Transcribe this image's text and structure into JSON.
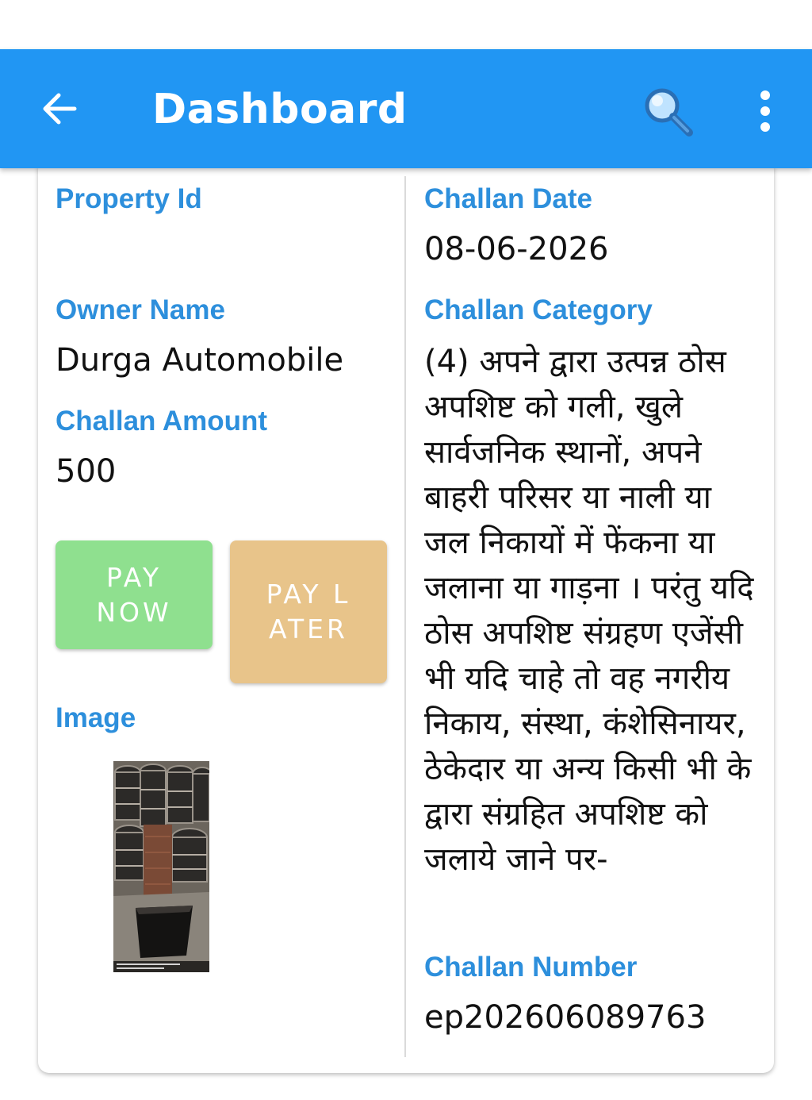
{
  "header": {
    "title": "Dashboard",
    "back_icon": "arrow-left-icon",
    "search_icon": "search-icon",
    "more_icon": "more-vertical-icon",
    "background": "#2196f3"
  },
  "challan": {
    "property_id_label": "Property Id",
    "property_id_value": "",
    "owner_name_label": "Owner Name",
    "owner_name_value": "Durga Automobile",
    "amount_label": "Challan Amount",
    "amount_value": "500",
    "image_label": "Image",
    "date_label": "Challan Date",
    "date_value": "08-06-2026",
    "category_label": "Challan Category",
    "category_value": "(4) अपने द्वारा उत्पन्न ठोस अपशिष्ट को गली, खुले सार्वजनिक स्थानों, अपने बाहरी परिसर या नाली या जल निकायों में फेंकना या जलाना या गाड़ना । परंतु यदि ठोस अपशिष्ट संग्रहण एजेंसी भी यदि चाहे तो वह नगरीय निकाय, संस्था, कंशेसिनायर, ठेकेदार या अन्य किसी भी के द्वारा संग्रहित अपशिष्ट को जलाये जाने पर-",
    "number_label": "Challan Number",
    "number_value": "ep202606089763"
  },
  "actions": {
    "pay_now_label": "PAY NOW",
    "pay_later_label": "PAY LATER",
    "pay_now_color": "#8fe08f",
    "pay_later_color": "#e8c48a"
  },
  "colors": {
    "label": "#2d8fdc",
    "value": "#111111"
  }
}
